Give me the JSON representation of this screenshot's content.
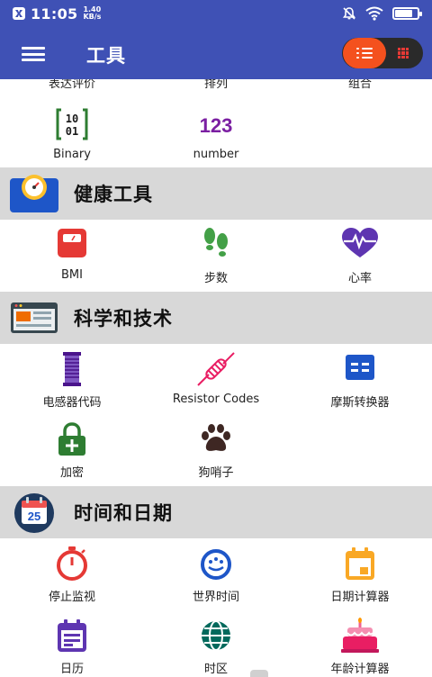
{
  "status_bar": {
    "time": "11:05",
    "speed_value": "1.40",
    "speed_unit": "KB/s",
    "battery_level": 0.8
  },
  "app_bar": {
    "title": "工具",
    "view_mode": "list"
  },
  "sections": [
    {
      "id": "math-tail",
      "items": [
        {
          "label": "表达评价",
          "icon": "expression-icon"
        },
        {
          "label": "排列",
          "icon": "permutation-icon"
        },
        {
          "label": "组合",
          "icon": "combination-icon"
        },
        {
          "label": "Binary",
          "icon": "binary-icon",
          "icon_text": [
            "10",
            "01"
          ],
          "color": "#2e7d32"
        },
        {
          "label": "number",
          "icon": "number-icon",
          "icon_text": "123",
          "color": "#7b1fa2"
        }
      ]
    },
    {
      "id": "health",
      "title": "健康工具",
      "icon": "scale-header-icon",
      "items": [
        {
          "label": "BMI",
          "icon": "bmi-scale-icon",
          "color": "#e53935"
        },
        {
          "label": "步数",
          "icon": "footsteps-icon",
          "color": "#43a047"
        },
        {
          "label": "心率",
          "icon": "heart-rate-icon",
          "color": "#5e35b1"
        }
      ]
    },
    {
      "id": "science",
      "title": "科学和技术",
      "icon": "browser-header-icon",
      "items": [
        {
          "label": "电感器代码",
          "icon": "inductor-icon",
          "color": "#6a1b9a"
        },
        {
          "label": "Resistor Codes",
          "icon": "resistor-icon",
          "color": "#e91e63"
        },
        {
          "label": "摩斯转换器",
          "icon": "morse-icon",
          "color": "#1e56c8"
        },
        {
          "label": "加密",
          "icon": "lock-icon",
          "color": "#2e7d32"
        },
        {
          "label": "狗哨子",
          "icon": "paw-icon",
          "color": "#3e2723"
        }
      ]
    },
    {
      "id": "time",
      "title": "时间和日期",
      "icon": "calendar-header-icon",
      "header_icon_text": "25",
      "items": [
        {
          "label": "停止监视",
          "icon": "stopwatch-icon",
          "color": "#e53935"
        },
        {
          "label": "世界时间",
          "icon": "world-clock-icon",
          "color": "#1e56c8"
        },
        {
          "label": "日期计算器",
          "icon": "date-calculator-icon",
          "color": "#f9a825"
        },
        {
          "label": "日历",
          "icon": "calendar-icon",
          "color": "#5e35b1"
        },
        {
          "label": "时区",
          "icon": "globe-icon",
          "color": "#00695c"
        },
        {
          "label": "年龄计算器",
          "icon": "birthday-cake-icon",
          "color": "#e91e63"
        }
      ]
    }
  ]
}
